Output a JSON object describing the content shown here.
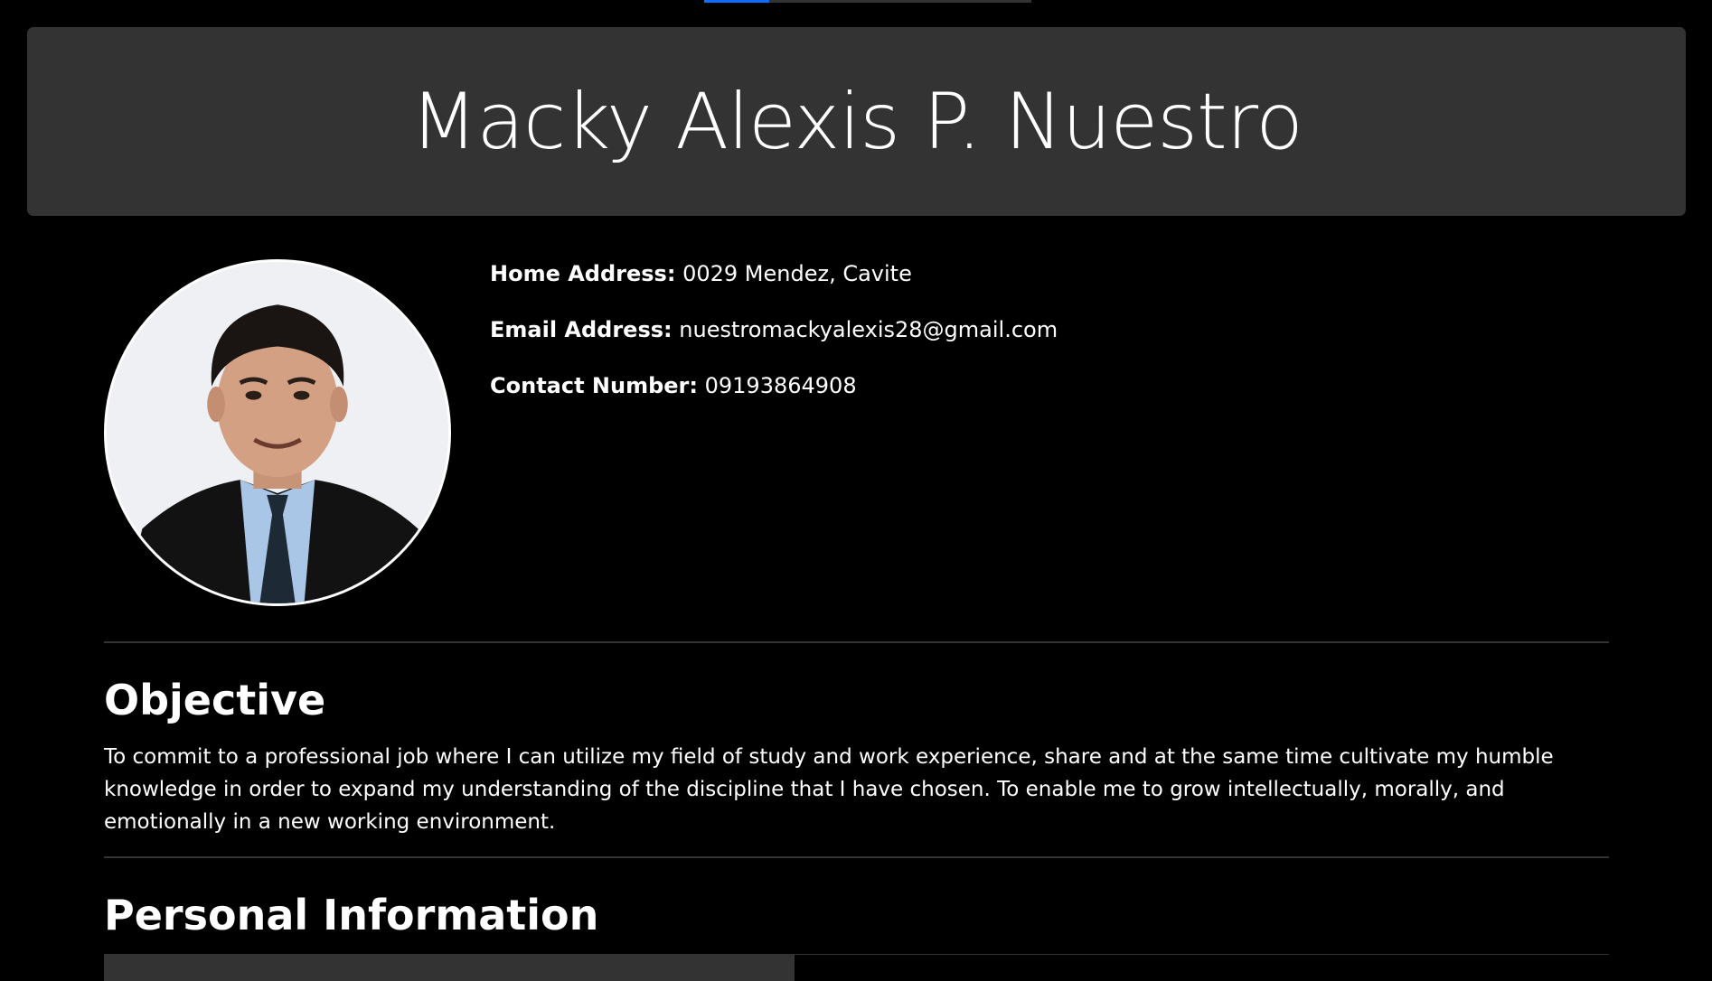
{
  "progress": {
    "value_percent": 20,
    "track_color": "#333333",
    "fill_color": "#0d6efd"
  },
  "header": {
    "name": "Macky Alexis P. Nuestro"
  },
  "photo": {
    "alt": "Profile photo"
  },
  "contact": {
    "home_label": "Home Address:",
    "home_value": "0029 Mendez, Cavite",
    "email_label": "Email Address:",
    "email_value": "nuestromackyalexis28@gmail.com",
    "phone_label": "Contact Number:",
    "phone_value": "09193864908"
  },
  "objective": {
    "title": "Objective",
    "text": "To commit to a professional job where I can utilize my field of study and work experience, share and at the same time cultivate my humble knowledge in order to expand my understanding of the discipline that I have chosen. To enable me to grow intellectually, morally, and emotionally in a new working environment."
  },
  "personal": {
    "title": "Personal Information"
  },
  "colors": {
    "background": "#000000",
    "panel": "#333333",
    "text": "#ffffff"
  }
}
